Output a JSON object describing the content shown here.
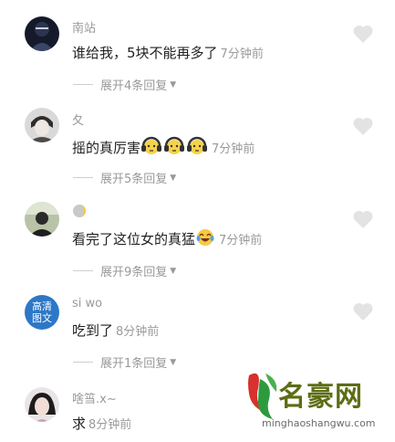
{
  "comments": [
    {
      "username": "南站",
      "text": "谁给我，5块不能再多了",
      "emojis": [],
      "time": "7分钟前",
      "replies": "展开4条回复"
    },
    {
      "username": "夂",
      "text": "摇的真厉害",
      "emojis": [
        "yellow-face-headphones-emoji",
        "yellow-face-headphones-emoji",
        "yellow-face-headphones-emoji"
      ],
      "time": "7分钟前",
      "replies": "展开5条回复"
    },
    {
      "username": "",
      "text": "看完了这位女的真猛",
      "emojis": [
        "laughing-tears-emoji"
      ],
      "time": "7分钟前",
      "replies": "展开9条回复"
    },
    {
      "username": "si wo",
      "avatar_text_top": "高清",
      "avatar_text_bottom": "图文",
      "text": "吃到了",
      "emojis": [],
      "time": "8分钟前",
      "replies": "展开1条回复"
    },
    {
      "username": "啥筜.x~",
      "text": "求",
      "emojis": [],
      "time": "8分钟前"
    }
  ],
  "watermark": {
    "title": "名豪网",
    "url": "minghaoshangwu.com"
  },
  "colors": {
    "name": "#9a9a9a",
    "text": "#222222",
    "meta": "#999999",
    "heart": "#e3e3e3",
    "watermark_green": "#5c6d14"
  }
}
